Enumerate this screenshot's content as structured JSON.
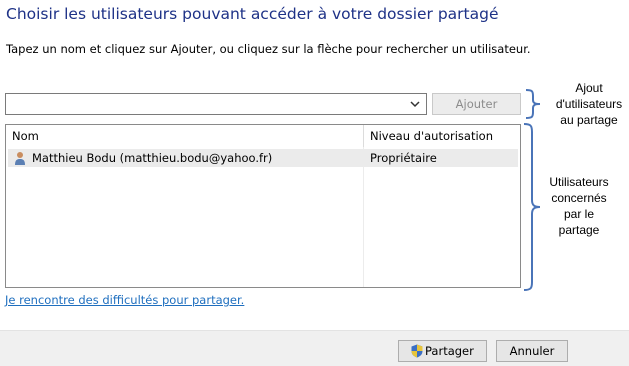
{
  "dialog": {
    "title": "Choisir les utilisateurs pouvant accéder à votre dossier partagé",
    "instruction": "Tapez un nom et cliquez sur Ajouter, ou cliquez sur la flèche pour rechercher un utilisateur.",
    "name_input": {
      "value": "",
      "dropdown_icon": "chevron-down-icon"
    },
    "add_button_label": "Ajouter",
    "table": {
      "columns": [
        "Nom",
        "Niveau d'autorisation"
      ],
      "rows": [
        {
          "name": "Matthieu Bodu (matthieu.bodu@yahoo.fr)",
          "level": "Propriétaire",
          "icon": "user-icon"
        }
      ]
    },
    "help_link": "Je rencontre des difficultés pour partager.",
    "footer": {
      "share_button_label": "Partager",
      "share_icon": "uac-shield-icon",
      "cancel_button_label": "Annuler"
    }
  },
  "annotations": {
    "top": [
      "Ajout",
      "d'utilisateurs",
      "au partage"
    ],
    "bottom": [
      "Utilisateurs",
      "concernés",
      "par le",
      "partage"
    ],
    "color": "#4a74b8"
  }
}
